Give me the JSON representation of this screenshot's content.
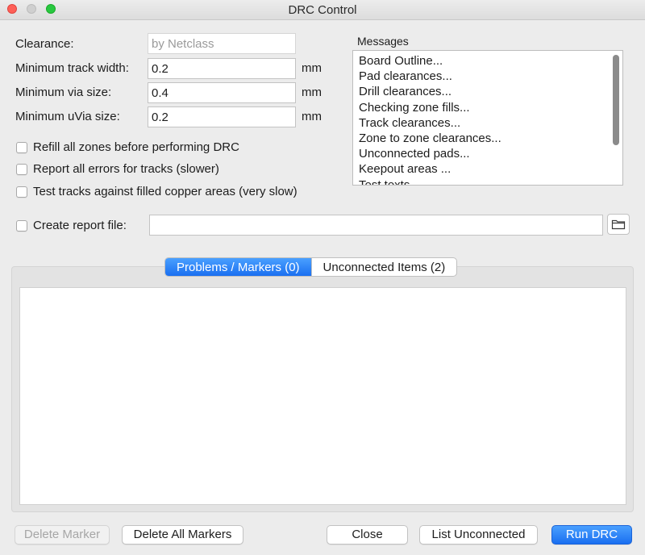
{
  "window": {
    "title": "DRC Control"
  },
  "settings": {
    "clearance_label": "Clearance:",
    "clearance_value": "by Netclass",
    "min_track_label": "Minimum track width:",
    "min_track_value": "0.2",
    "min_via_label": "Minimum via size:",
    "min_via_value": "0.4",
    "min_uvia_label": "Minimum uVia size:",
    "min_uvia_value": "0.2",
    "unit": "mm"
  },
  "options": {
    "refill_zones": "Refill all zones before performing DRC",
    "report_all_errors": "Report all errors for tracks (slower)",
    "test_filled_areas": "Test tracks against filled copper areas (very slow)",
    "create_report": "Create report file:",
    "report_path": ""
  },
  "messages": {
    "title": "Messages",
    "lines": [
      "Board Outline...",
      "Pad clearances...",
      "Drill clearances...",
      "Checking zone fills...",
      "Track clearances...",
      "Zone to zone clearances...",
      "Unconnected pads...",
      "Keepout areas ...",
      "Test texts..."
    ]
  },
  "tabs": {
    "problems": "Problems / Markers (0)",
    "unconnected": "Unconnected Items (2)"
  },
  "buttons": {
    "delete_marker": "Delete Marker",
    "delete_all": "Delete All Markers",
    "close": "Close",
    "list_unconnected": "List Unconnected",
    "run_drc": "Run DRC"
  },
  "icons": {
    "folder": "folder-icon"
  },
  "colors": {
    "accent": "#1a6ff0",
    "close_light": "#fe5f57",
    "zoom_light": "#28c840"
  }
}
